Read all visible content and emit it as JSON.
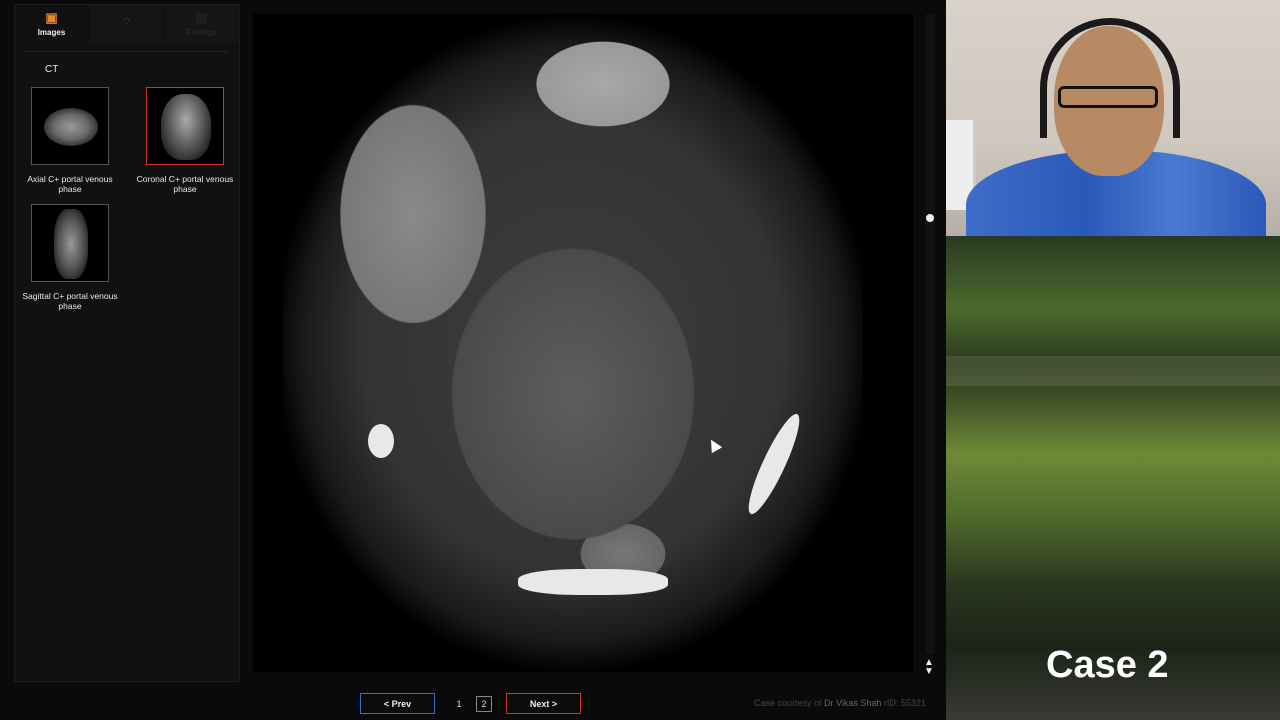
{
  "sidebar": {
    "tabs": [
      {
        "label": "Images",
        "icon": "image-icon"
      },
      {
        "label": "",
        "icon": "help-icon"
      },
      {
        "label": "Findings",
        "icon": "findings-icon"
      }
    ],
    "modality": "CT",
    "thumbnails": [
      {
        "caption": "Axial C+ portal venous phase",
        "selected": false
      },
      {
        "caption": "Coronal C+ portal venous phase",
        "selected": true
      },
      {
        "caption": "Sagittal C+ portal venous phase",
        "selected": false
      }
    ]
  },
  "pager": {
    "prev_label": "<   Prev",
    "pages": [
      "1",
      "2"
    ],
    "current_page": "2",
    "next_label": "Next   >"
  },
  "credit": {
    "prefix": "Case courtesy of ",
    "author": "Dr Vikas Shah",
    "rid": " rID: 55321"
  },
  "overlay": {
    "case_title": "Case 2"
  },
  "colors": {
    "accent_orange": "#e8862c",
    "selected_border": "#d0372c",
    "prev_border": "#3a6cc8"
  }
}
